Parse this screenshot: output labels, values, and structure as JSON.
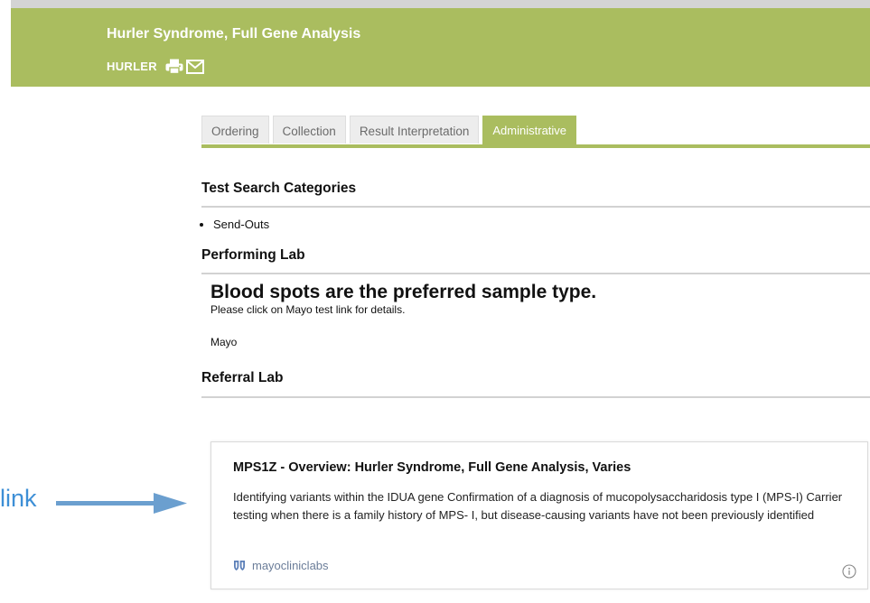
{
  "header": {
    "title": "Hurler Syndrome, Full Gene Analysis",
    "code": "HURLER",
    "icons": [
      "printer-icon",
      "mail-icon"
    ]
  },
  "tabs": [
    {
      "label": "Ordering",
      "active": false
    },
    {
      "label": "Collection",
      "active": false
    },
    {
      "label": "Result Interpretation",
      "active": false
    },
    {
      "label": "Administrative",
      "active": true
    }
  ],
  "sections": {
    "categories": {
      "heading": "Test Search Categories",
      "items": [
        "Send-Outs"
      ]
    },
    "performing": {
      "heading": "Performing Lab",
      "notice": "Blood spots are the preferred sample type.",
      "note": "Please click on Mayo test link for details.",
      "lab": "Mayo"
    },
    "referral": {
      "heading": "Referral Lab"
    }
  },
  "card": {
    "title": "MPS1Z - Overview: Hurler Syndrome, Full Gene Analysis, Varies",
    "description": "Identifying variants within the IDUA gene Confirmation of a diagnosis of mucopolysaccharidosis type I (MPS-I) Carrier testing when there is a family history of MPS- I, but disease-causing variants have not been previously identified",
    "source": "mayocliniclabs",
    "icons": [
      "mayo-shield-icon",
      "info-icon"
    ]
  },
  "annotation": {
    "label": "link",
    "color": "#3d8fd6"
  },
  "colors": {
    "brand_green": "#aabd5f",
    "rule_gray": "#d2d2d2"
  }
}
